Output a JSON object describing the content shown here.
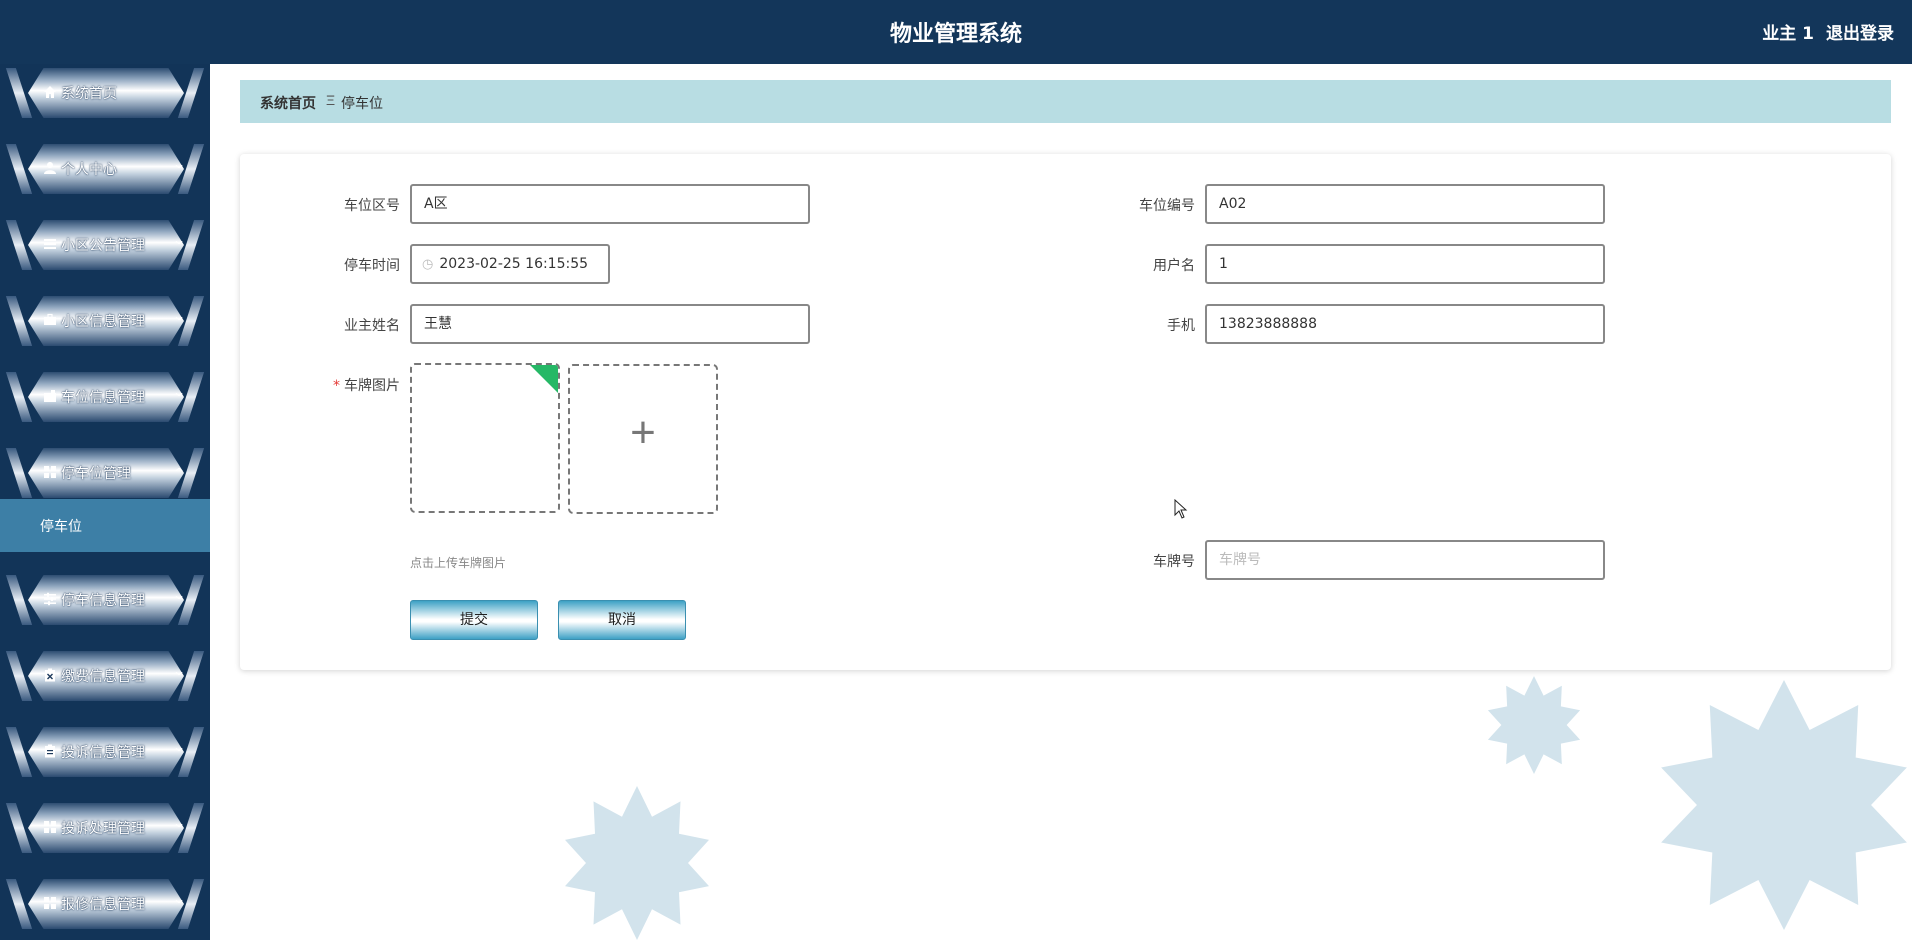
{
  "header": {
    "title": "物业管理系统",
    "user_label": "业主 1",
    "logout_label": "退出登录"
  },
  "sidebar": {
    "items": [
      {
        "label": "系统首页",
        "icon": "home-icon",
        "has_arrow": false
      },
      {
        "label": "个人中心",
        "icon": "user-icon",
        "has_arrow": true
      },
      {
        "label": "小区公告管理",
        "icon": "list-icon",
        "has_arrow": true
      },
      {
        "label": "小区信息管理",
        "icon": "briefcase-icon",
        "has_arrow": true
      },
      {
        "label": "车位信息管理",
        "icon": "wallet-icon",
        "has_arrow": true
      },
      {
        "label": "停车位管理",
        "icon": "grid-icon",
        "has_arrow": true,
        "expanded": true
      },
      {
        "label": "停车信息管理",
        "icon": "sliders-icon",
        "has_arrow": true
      },
      {
        "label": "缴费信息管理",
        "icon": "clipboard-x-icon",
        "has_arrow": true
      },
      {
        "label": "投诉信息管理",
        "icon": "clipboard-icon",
        "has_arrow": true
      },
      {
        "label": "投诉处理管理",
        "icon": "grid-icon",
        "has_arrow": true
      },
      {
        "label": "报修信息管理",
        "icon": "grid-icon",
        "has_arrow": true
      }
    ],
    "active_sub": "停车位"
  },
  "breadcrumb": {
    "home": "系统首页",
    "separator": "Ξ",
    "current": "停车位"
  },
  "form": {
    "area": {
      "label": "车位区号",
      "value": "A区"
    },
    "code": {
      "label": "车位编号",
      "value": "A02"
    },
    "park_time": {
      "label": "停车时间",
      "value": "2023-02-25 16:15:55"
    },
    "username": {
      "label": "用户名",
      "value": "1"
    },
    "owner_name": {
      "label": "业主姓名",
      "value": "王慧"
    },
    "phone": {
      "label": "手机",
      "value": "13823888888"
    },
    "plate_image": {
      "label": "车牌图片",
      "required_mark": "*",
      "tip": "点击上传车牌图片"
    },
    "plate_number": {
      "label": "车牌号",
      "placeholder": "车牌号",
      "value": ""
    },
    "submit_label": "提交",
    "cancel_label": "取消"
  },
  "colors": {
    "header_bg": "#13365a",
    "sidebar_bg": "#123458",
    "active_sub_bg": "#3d7fa6",
    "breadcrumb_bg": "#b8dde3",
    "accent_green": "#25b866"
  }
}
